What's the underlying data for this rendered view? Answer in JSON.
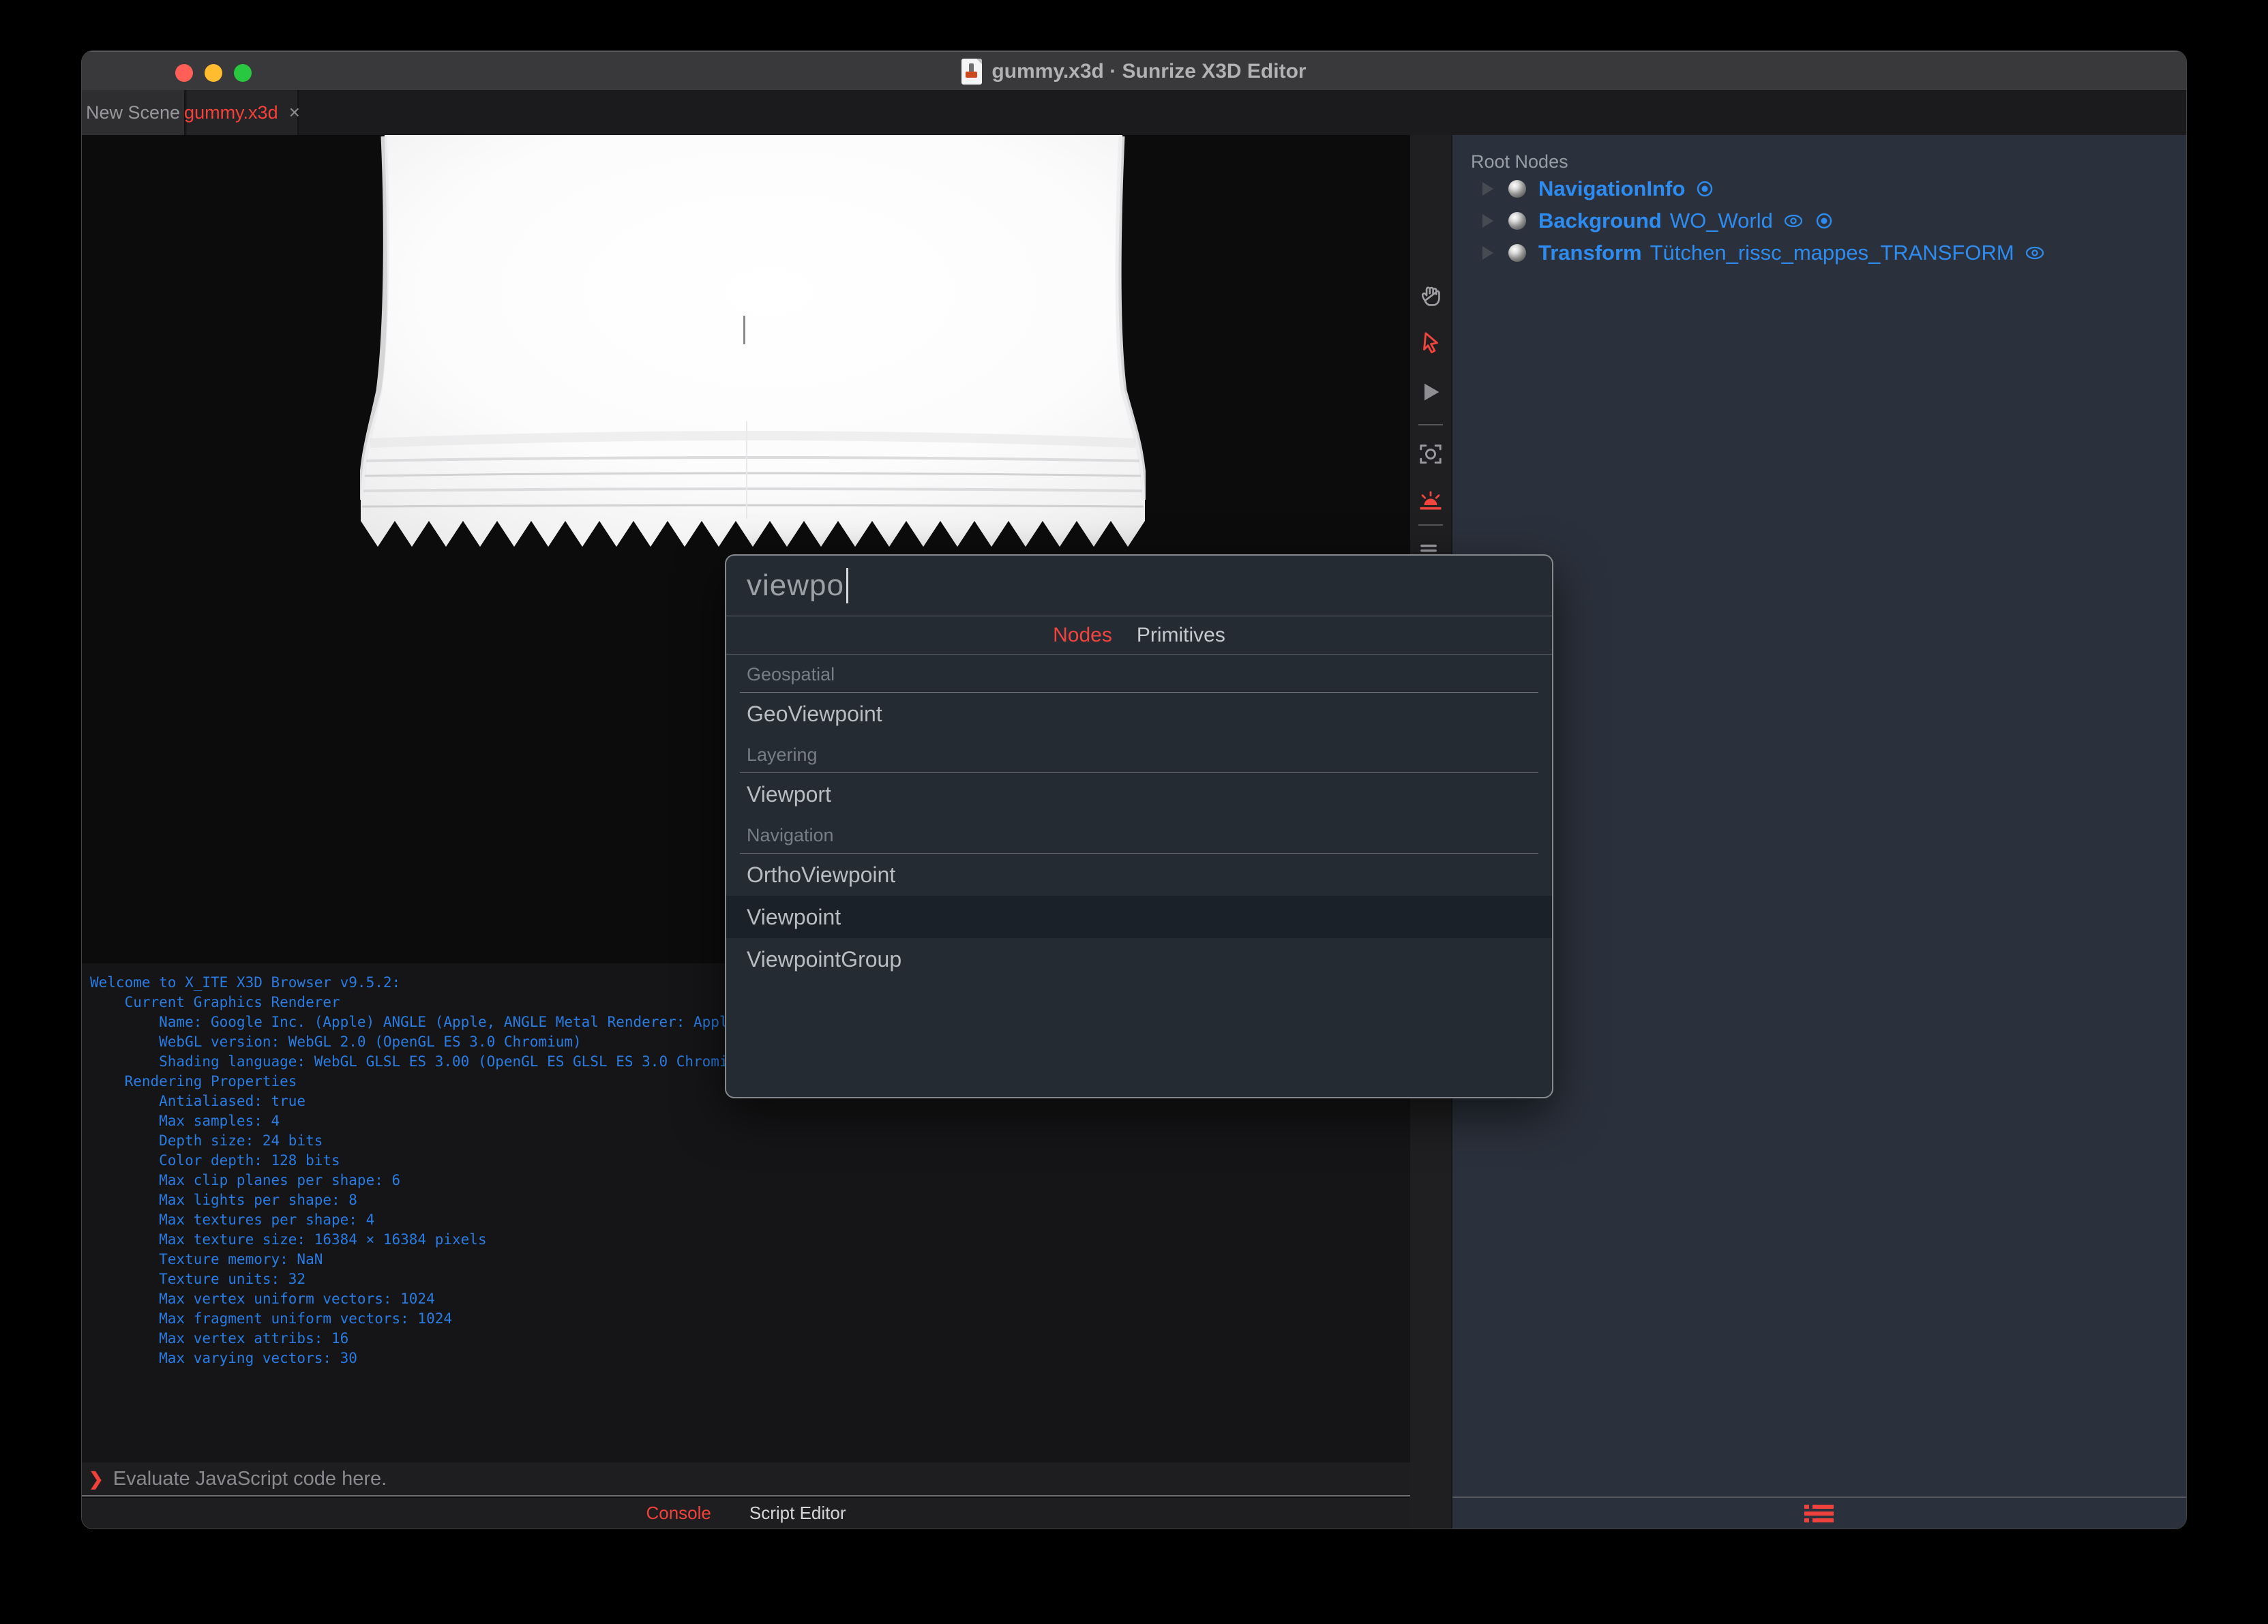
{
  "titlebar": {
    "title": "gummy.x3d · Sunrize X3D Editor"
  },
  "tabs": {
    "new_scene": "New Scene",
    "active_file": "gummy.x3d",
    "close": "×"
  },
  "outline": {
    "header": "Root Nodes",
    "nodes": [
      {
        "type": "NavigationInfo",
        "name": ""
      },
      {
        "type": "Background",
        "name": "WO_World"
      },
      {
        "type": "Transform",
        "name": "Tütchen_rissc_mappes_TRANSFORM"
      }
    ]
  },
  "console": {
    "lines": [
      "Welcome to X_ITE X3D Browser v9.5.2:",
      "    Current Graphics Renderer",
      "        Name: Google Inc. (Apple) ANGLE (Apple, ANGLE Metal Renderer: Apple",
      "        WebGL version: WebGL 2.0 (OpenGL ES 3.0 Chromium)",
      "        Shading language: WebGL GLSL ES 3.00 (OpenGL ES GLSL ES 3.0 Chromium",
      "    Rendering Properties",
      "        Antialiased: true",
      "        Max samples: 4",
      "        Depth size: 24 bits",
      "        Color depth: 128 bits",
      "        Max clip planes per shape: 6",
      "        Max lights per shape: 8",
      "        Max textures per shape: 4",
      "        Max texture size: 16384 × 16384 pixels",
      "        Texture memory: NaN",
      "        Texture units: 32",
      "        Max vertex uniform vectors: 1024",
      "        Max fragment uniform vectors: 1024",
      "        Max vertex attribs: 16",
      "        Max varying vectors: 30"
    ]
  },
  "prompt": {
    "chevron": "❯",
    "placeholder": "Evaluate JavaScript code here."
  },
  "bottom_tabs": {
    "console": "Console",
    "script_editor": "Script Editor"
  },
  "dialog": {
    "query": "viewpo",
    "tabs": {
      "nodes": "Nodes",
      "primitives": "Primitives"
    },
    "sections": [
      {
        "label": "Geospatial",
        "items": [
          "GeoViewpoint"
        ]
      },
      {
        "label": "Layering",
        "items": [
          "Viewport"
        ]
      },
      {
        "label": "Navigation",
        "items": [
          "OrthoViewpoint",
          "Viewpoint",
          "ViewpointGroup"
        ]
      }
    ],
    "selected_item": "Viewpoint"
  },
  "colors": {
    "accent_red": "#f0423c",
    "node_blue": "#2e8cf0",
    "console_blue": "#2a7ce2",
    "panel_bg": "#2b313c",
    "dialog_bg": "#252b33",
    "titlebar_bg": "#39393b",
    "viewport_bg": "#0c0c0c"
  }
}
